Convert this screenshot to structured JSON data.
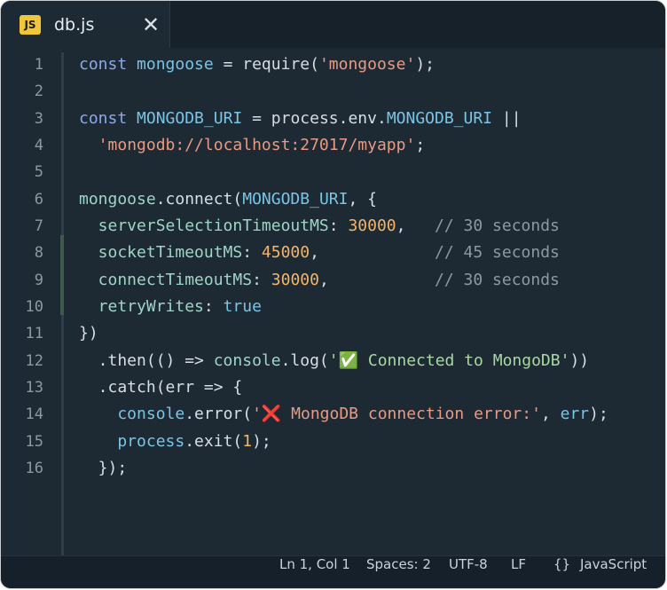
{
  "tab": {
    "badge": "JS",
    "title": "db.js",
    "close_glyph": "✕"
  },
  "editor": {
    "lines": [
      {
        "n": "1",
        "tokens": [
          {
            "t": "const ",
            "c": "kw"
          },
          {
            "t": "mongoose",
            "c": "var"
          },
          {
            "t": " = ",
            "c": "plain"
          },
          {
            "t": "require",
            "c": "fn"
          },
          {
            "t": "(",
            "c": "plain"
          },
          {
            "t": "'mongoose'",
            "c": "str"
          },
          {
            "t": ");",
            "c": "plain"
          }
        ]
      },
      {
        "n": "2",
        "tokens": []
      },
      {
        "n": "3",
        "tokens": [
          {
            "t": "const ",
            "c": "kw"
          },
          {
            "t": "MONGODB_URI",
            "c": "var"
          },
          {
            "t": " = ",
            "c": "plain"
          },
          {
            "t": "process",
            "c": "fn"
          },
          {
            "t": ".env.",
            "c": "plain"
          },
          {
            "t": "MONGODB_URI",
            "c": "var"
          },
          {
            "t": " ||",
            "c": "plain"
          }
        ]
      },
      {
        "n": "4",
        "tokens": [
          {
            "t": "  ",
            "c": "plain"
          },
          {
            "t": "'mongodb://localhost:27017/myapp'",
            "c": "str"
          },
          {
            "t": ";",
            "c": "plain"
          }
        ]
      },
      {
        "n": "5",
        "tokens": []
      },
      {
        "n": "6",
        "tokens": [
          {
            "t": "mongoose",
            "c": "prop"
          },
          {
            "t": ".connect(",
            "c": "plain"
          },
          {
            "t": "MONGODB_URI",
            "c": "var"
          },
          {
            "t": ", {",
            "c": "plain"
          }
        ]
      },
      {
        "n": "7",
        "tokens": [
          {
            "t": "  serverSelectionTimeoutMS",
            "c": "prop"
          },
          {
            "t": ": ",
            "c": "plain"
          },
          {
            "t": "30000",
            "c": "num"
          },
          {
            "t": ",   ",
            "c": "plain"
          },
          {
            "t": "// 30 seconds",
            "c": "cmt"
          }
        ]
      },
      {
        "n": "8",
        "tokens": [
          {
            "t": "  socketTimeoutMS",
            "c": "prop"
          },
          {
            "t": ": ",
            "c": "plain"
          },
          {
            "t": "45000",
            "c": "num"
          },
          {
            "t": ",            ",
            "c": "plain"
          },
          {
            "t": "// 45 seconds",
            "c": "cmt"
          }
        ]
      },
      {
        "n": "9",
        "tokens": [
          {
            "t": "  connectTimeoutMS",
            "c": "prop"
          },
          {
            "t": ": ",
            "c": "plain"
          },
          {
            "t": "30000",
            "c": "num"
          },
          {
            "t": ",           ",
            "c": "plain"
          },
          {
            "t": "// 30 seconds",
            "c": "cmt"
          }
        ]
      },
      {
        "n": "10",
        "tokens": [
          {
            "t": "  retryWrites",
            "c": "prop"
          },
          {
            "t": ": ",
            "c": "plain"
          },
          {
            "t": "true",
            "c": "lit"
          }
        ]
      },
      {
        "n": "11",
        "tokens": [
          {
            "t": "})",
            "c": "plain"
          }
        ]
      },
      {
        "n": "12",
        "tokens": [
          {
            "t": "  .then(() => ",
            "c": "plain"
          },
          {
            "t": "console",
            "c": "prop"
          },
          {
            "t": ".log(",
            "c": "plain"
          },
          {
            "t": "'✅ Connected to MongoDB'",
            "c": "str2"
          },
          {
            "t": "))",
            "c": "plain"
          }
        ]
      },
      {
        "n": "13",
        "tokens": [
          {
            "t": "  .catch(",
            "c": "plain"
          },
          {
            "t": "err",
            "c": "plain"
          },
          {
            "t": " => {",
            "c": "plain"
          }
        ]
      },
      {
        "n": "14",
        "tokens": [
          {
            "t": "    console",
            "c": "var"
          },
          {
            "t": ".error(",
            "c": "plain"
          },
          {
            "t": "'❌ MongoDB connection error:'",
            "c": "str"
          },
          {
            "t": ", ",
            "c": "plain"
          },
          {
            "t": "err",
            "c": "var"
          },
          {
            "t": ");",
            "c": "plain"
          }
        ]
      },
      {
        "n": "15",
        "tokens": [
          {
            "t": "    process",
            "c": "var"
          },
          {
            "t": ".exit(",
            "c": "plain"
          },
          {
            "t": "1",
            "c": "num"
          },
          {
            "t": ");",
            "c": "plain"
          }
        ]
      },
      {
        "n": "16",
        "tokens": [
          {
            "t": "  });",
            "c": "plain"
          }
        ]
      }
    ],
    "colors": {
      "background": "#1e2a33",
      "keyword": "#8da8e8",
      "string": "#e89a84",
      "number": "#f2b56b",
      "comment": "#8c99a3"
    }
  },
  "status": {
    "position": "Ln 1, Col 1",
    "spaces": "Spaces: 2",
    "encoding": "UTF-8",
    "eol": "LF",
    "language_icon": "{}",
    "language": "JavaScript"
  }
}
